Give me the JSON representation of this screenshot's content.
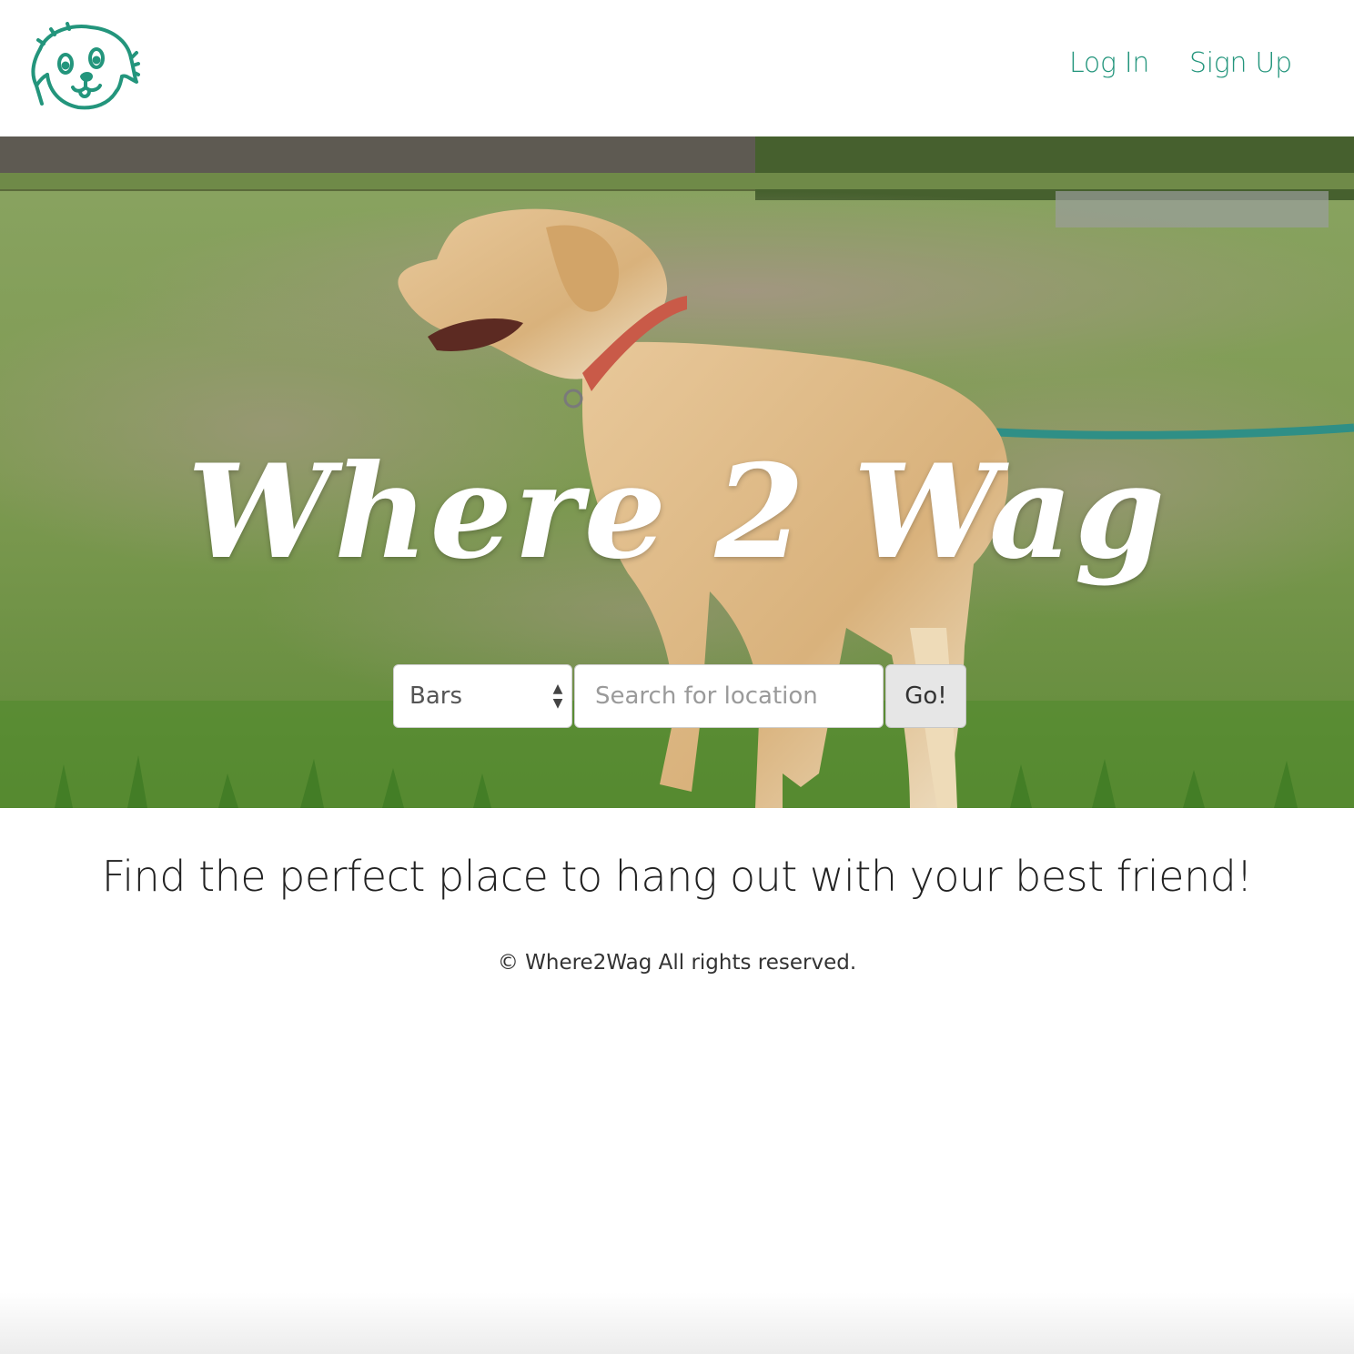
{
  "brand": {
    "logo_icon": "dog-face-icon",
    "accent_color": "#23957c"
  },
  "nav": {
    "login_label": "Log In",
    "signup_label": "Sign Up"
  },
  "hero": {
    "image": "dog-in-park-photo",
    "title": "Where 2 Wag",
    "search": {
      "category_selected": "Bars",
      "location_placeholder": "Search for location",
      "submit_label": "Go!"
    }
  },
  "tagline": "Find the perfect place to hang out with your best friend!",
  "footer": {
    "copyright": "© Where2Wag All rights reserved."
  }
}
